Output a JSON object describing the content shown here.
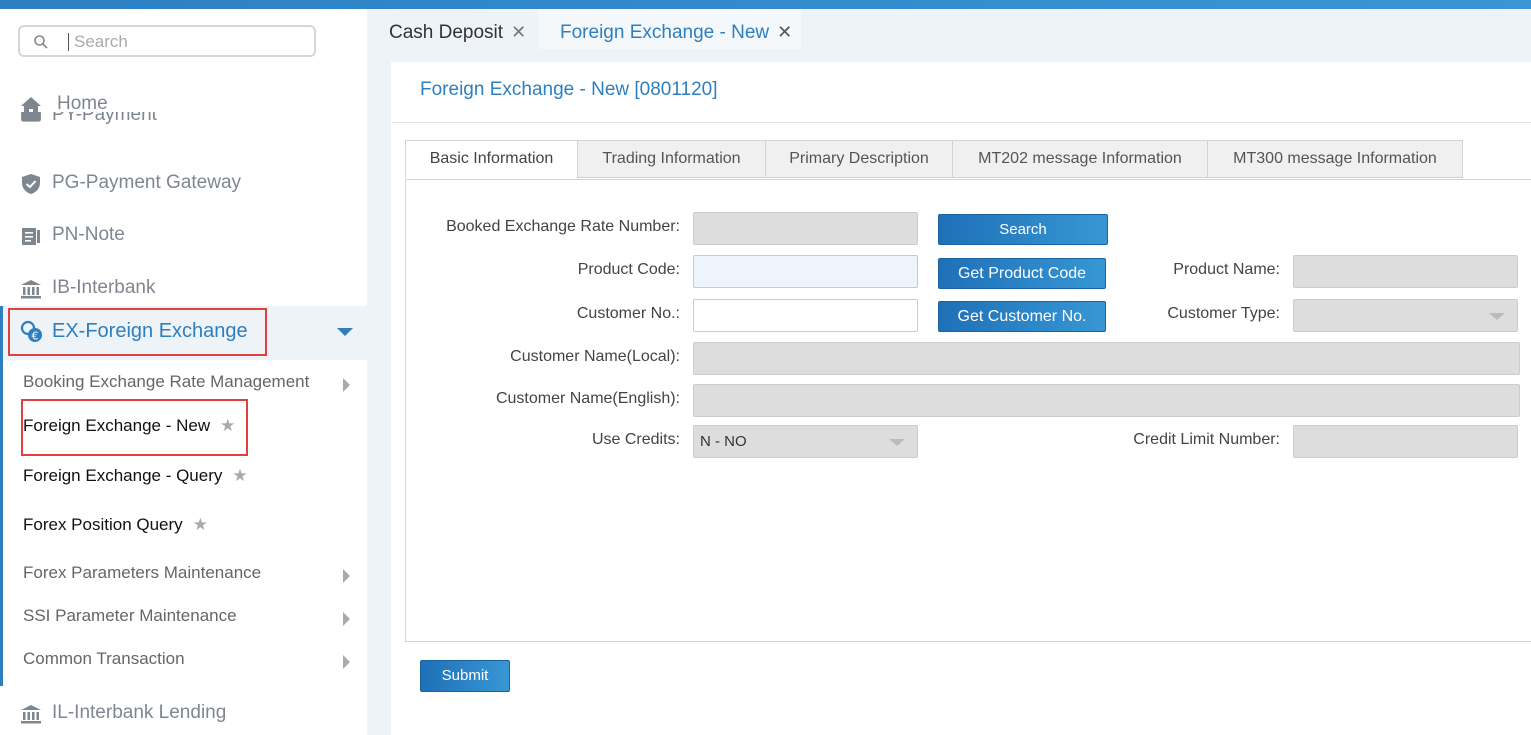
{
  "search": {
    "placeholder": "Search"
  },
  "sidebar": {
    "items": [
      {
        "label": "Home",
        "icon": "home-icon"
      },
      {
        "label": "PY-Payment",
        "icon": "payment-icon"
      },
      {
        "label": "PG-Payment Gateway",
        "icon": "shield-icon"
      },
      {
        "label": "PN-Note",
        "icon": "note-icon"
      },
      {
        "label": "IB-Interbank",
        "icon": "bank-icon"
      },
      {
        "label": "EX-Foreign Exchange",
        "icon": "exchange-icon"
      },
      {
        "label": "IL-Interbank Lending",
        "icon": "bank-icon"
      }
    ],
    "sub_items": [
      {
        "label": "Booking Exchange Rate Management",
        "has_children": true
      },
      {
        "label": "Foreign Exchange - New",
        "favorite": true
      },
      {
        "label": "Foreign Exchange - Query",
        "favorite": true
      },
      {
        "label": "Forex Position Query",
        "favorite": true
      },
      {
        "label": "Forex Parameters Maintenance",
        "has_children": true
      },
      {
        "label": "SSI Parameter Maintenance",
        "has_children": true
      },
      {
        "label": "Common Transaction",
        "has_children": true
      }
    ]
  },
  "tabs": [
    {
      "label": "Cash Deposit",
      "active": false
    },
    {
      "label": "Foreign Exchange - New",
      "active": true
    }
  ],
  "page": {
    "title": "Foreign Exchange - New [0801120]",
    "form_tabs": [
      "Basic Information",
      "Trading Information",
      "Primary Description",
      "MT202 message Information",
      "MT300 message Information"
    ],
    "fields": {
      "booked_rate_label": "Booked Exchange Rate Number:",
      "product_code_label": "Product Code:",
      "product_name_label": "Product Name:",
      "customer_no_label": "Customer No.:",
      "customer_type_label": "Customer Type:",
      "customer_name_local_label": "Customer Name(Local):",
      "customer_name_english_label": "Customer Name(English):",
      "use_credits_label": "Use Credits:",
      "use_credits_value": "N - NO",
      "credit_limit_label": "Credit Limit Number:"
    },
    "buttons": {
      "search": "Search",
      "get_product_code": "Get Product Code",
      "get_customer_no": "Get Customer No.",
      "submit": "Submit"
    }
  },
  "colors": {
    "accent": "#2d7fc0",
    "highlight_box": "#e04040"
  }
}
